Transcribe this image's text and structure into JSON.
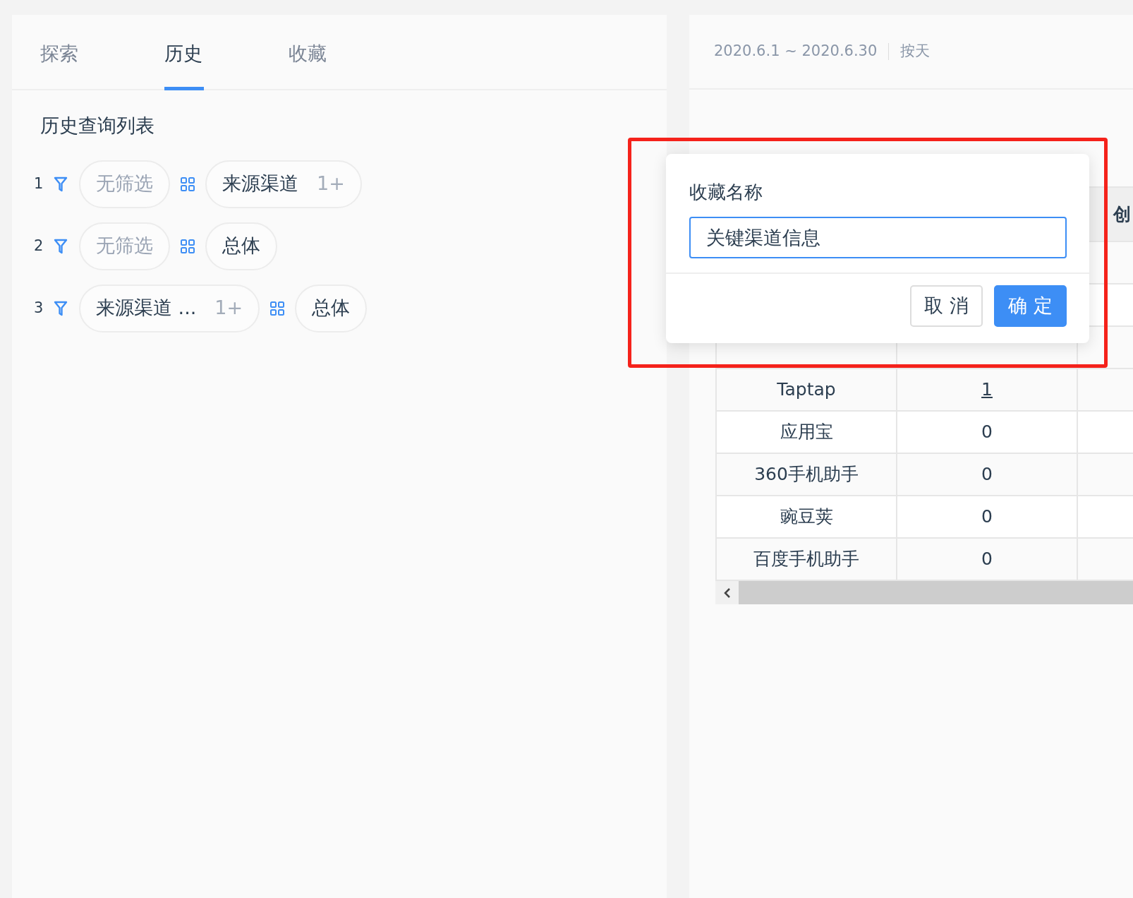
{
  "tabs": [
    {
      "label": "探索",
      "selected": false
    },
    {
      "label": "历史",
      "selected": true
    },
    {
      "label": "收藏",
      "selected": false
    }
  ],
  "history": {
    "title": "历史查询列表",
    "items": [
      {
        "index": "1",
        "filter": {
          "text": "无筛选",
          "empty": true
        },
        "dimension": {
          "text": "来源渠道",
          "count": "1+"
        }
      },
      {
        "index": "2",
        "filter": {
          "text": "无筛选",
          "empty": true
        },
        "dimension": {
          "text": "总体"
        }
      },
      {
        "index": "3",
        "filter": {
          "text": "来源渠道 ...",
          "count": "1+",
          "empty": false
        },
        "dimension": {
          "text": "总体"
        }
      }
    ]
  },
  "report": {
    "date_range": "2020.6.1 ~ 2020.6.30",
    "granularity": "按天",
    "table": {
      "column_3_header": "创",
      "rows": [
        {
          "channel": "Taptap",
          "value": "1",
          "linked": true
        },
        {
          "channel": "应用宝",
          "value": "0",
          "linked": false
        },
        {
          "channel": "360手机助手",
          "value": "0",
          "linked": false
        },
        {
          "channel": "豌豆荚",
          "value": "0",
          "linked": false
        },
        {
          "channel": "百度手机助手",
          "value": "0",
          "linked": false
        }
      ]
    }
  },
  "dialog": {
    "label": "收藏名称",
    "value": "关键渠道信息",
    "buttons": [
      {
        "label": "取 消",
        "kind": "default"
      },
      {
        "label": "确 定",
        "kind": "primary"
      }
    ]
  }
}
